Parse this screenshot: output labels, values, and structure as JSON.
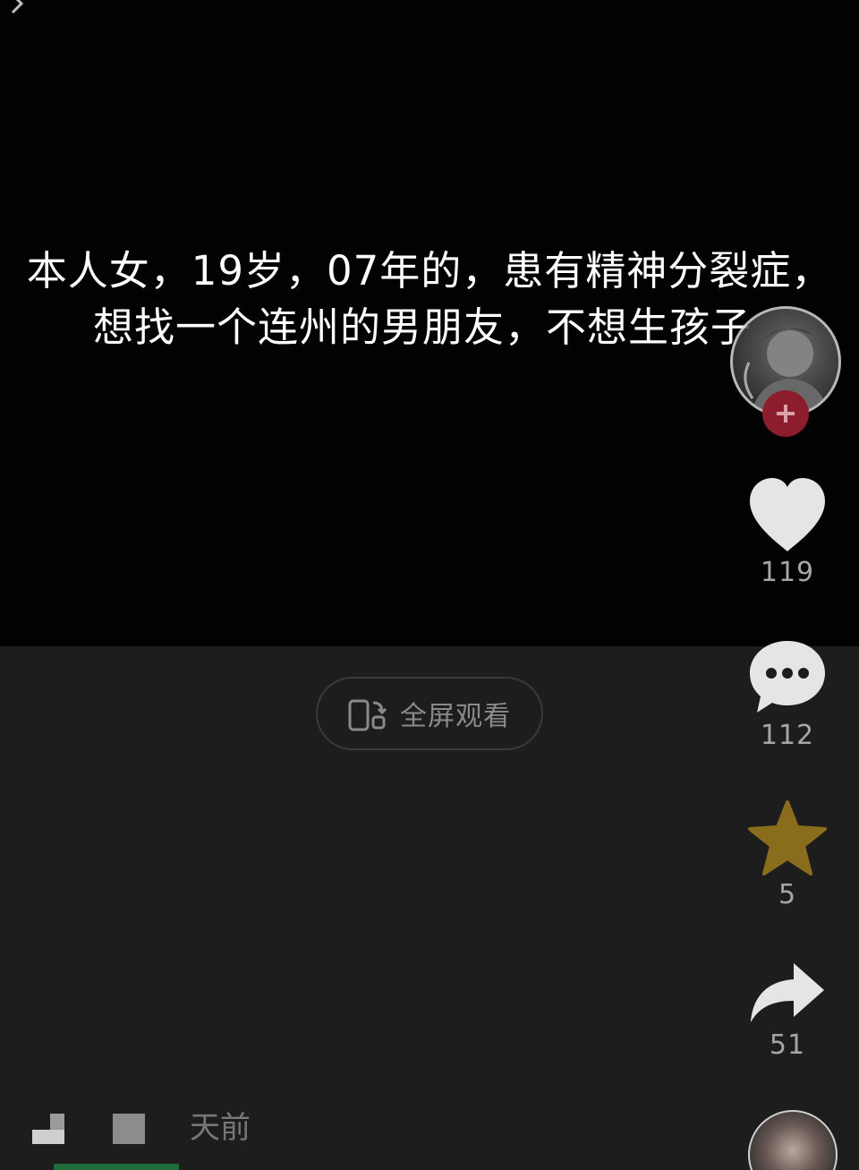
{
  "caption": {
    "line1": "本人女，19岁，07年的，患有精神分裂症，",
    "line2": "想找一个连州的男朋友，不想生孩子"
  },
  "fullscreen": {
    "label": "全屏观看",
    "icon": "rotate-phone-icon"
  },
  "rail": {
    "avatar_icon": "author-avatar",
    "follow_icon": "plus-icon",
    "like": {
      "icon": "heart-icon",
      "count": "119",
      "color": "#e5e5e5"
    },
    "comment": {
      "icon": "speech-bubble-icon",
      "count": "112",
      "color": "#e5e5e5"
    },
    "favorite": {
      "icon": "star-icon",
      "count": "5",
      "color": "#8a6d1c"
    },
    "share": {
      "icon": "share-arrow-icon",
      "count": "51",
      "color": "#e5e5e5"
    }
  },
  "meta": {
    "time_text": "天前"
  },
  "colors": {
    "video_bg": "#020202",
    "page_bg": "#1d1d1d",
    "follow_red": "#8c1d2c"
  }
}
